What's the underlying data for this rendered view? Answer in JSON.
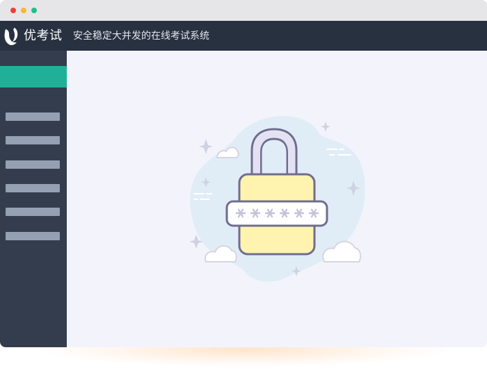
{
  "window": {
    "controls": [
      "close",
      "minimize",
      "maximize"
    ],
    "colors": {
      "close": "#ee3f37",
      "minimize": "#f7b731",
      "maximize": "#1fbf8f"
    }
  },
  "header": {
    "brand": "优考试",
    "slogan": "安全稳定大并发的在线考试系统",
    "logo_icon": "leaf-u-logo-icon",
    "background": "#283140"
  },
  "sidebar": {
    "active_item_color": "#20b097",
    "background": "#343d4d",
    "item_count": 6
  },
  "main": {
    "illustration": {
      "icon": "padlock-password-icon",
      "password_mask": "******",
      "lock_body_color": "#fff3b0",
      "outline_color": "#6f6d8f",
      "blob_color": "#e1edf6"
    }
  }
}
